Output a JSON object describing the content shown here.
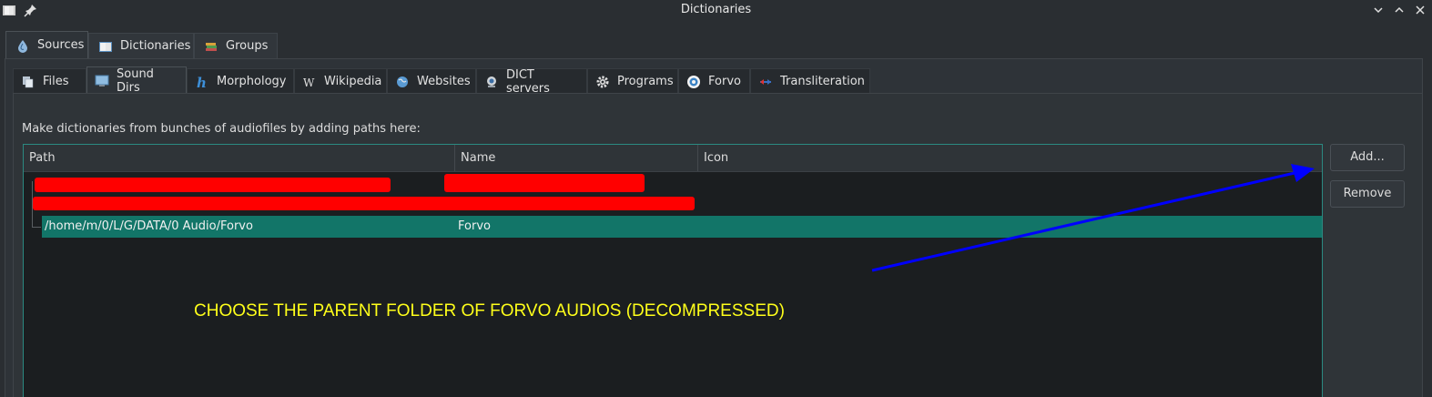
{
  "window": {
    "title": "Dictionaries",
    "icons": [
      "app-dictionary-icon",
      "pin-icon"
    ],
    "controls": [
      "minimize-icon",
      "maximize-icon",
      "close-icon"
    ]
  },
  "top_tabs": [
    {
      "label": "Sources",
      "icon": "water-drop-icon",
      "active": true
    },
    {
      "label": "Dictionaries",
      "icon": "book-icon",
      "active": false
    },
    {
      "label": "Groups",
      "icon": "books-stack-icon",
      "active": false
    }
  ],
  "sub_tabs": [
    {
      "label": "Files",
      "icon": "files-icon",
      "active": false
    },
    {
      "label": "Sound Dirs",
      "icon": "monitor-folder-icon",
      "active": true
    },
    {
      "label": "Morphology",
      "icon": "hunspell-h-icon",
      "active": false
    },
    {
      "label": "Wikipedia",
      "icon": "wikipedia-w-icon",
      "active": false
    },
    {
      "label": "Websites",
      "icon": "globe-icon",
      "active": false
    },
    {
      "label": "DICT servers",
      "icon": "server-icon",
      "active": false
    },
    {
      "label": "Programs",
      "icon": "gear-icon",
      "active": false
    },
    {
      "label": "Forvo",
      "icon": "forvo-icon",
      "active": false
    },
    {
      "label": "Transliteration",
      "icon": "arrows-icon",
      "active": false
    }
  ],
  "description": "Make dictionaries from bunches of audiofiles by adding paths here:",
  "table": {
    "columns": [
      "Path",
      "Name",
      "Icon"
    ],
    "rows": [
      {
        "path": "/home/m/0/L/G/DATA/0 Audio/Forvo",
        "name": "Forvo",
        "icon": "",
        "selected": true
      }
    ]
  },
  "buttons": {
    "add": "Add...",
    "remove": "Remove"
  },
  "annotation": "CHOOSE THE PARENT FOLDER OF FORVO AUDIOS (DECOMPRESSED)",
  "colors": {
    "background": "#2a2e32",
    "selection": "#127568",
    "table_border": "#2b8a81",
    "redaction": "#ff0000",
    "annotation_text": "#ffff1a",
    "arrow": "#0000ff"
  }
}
